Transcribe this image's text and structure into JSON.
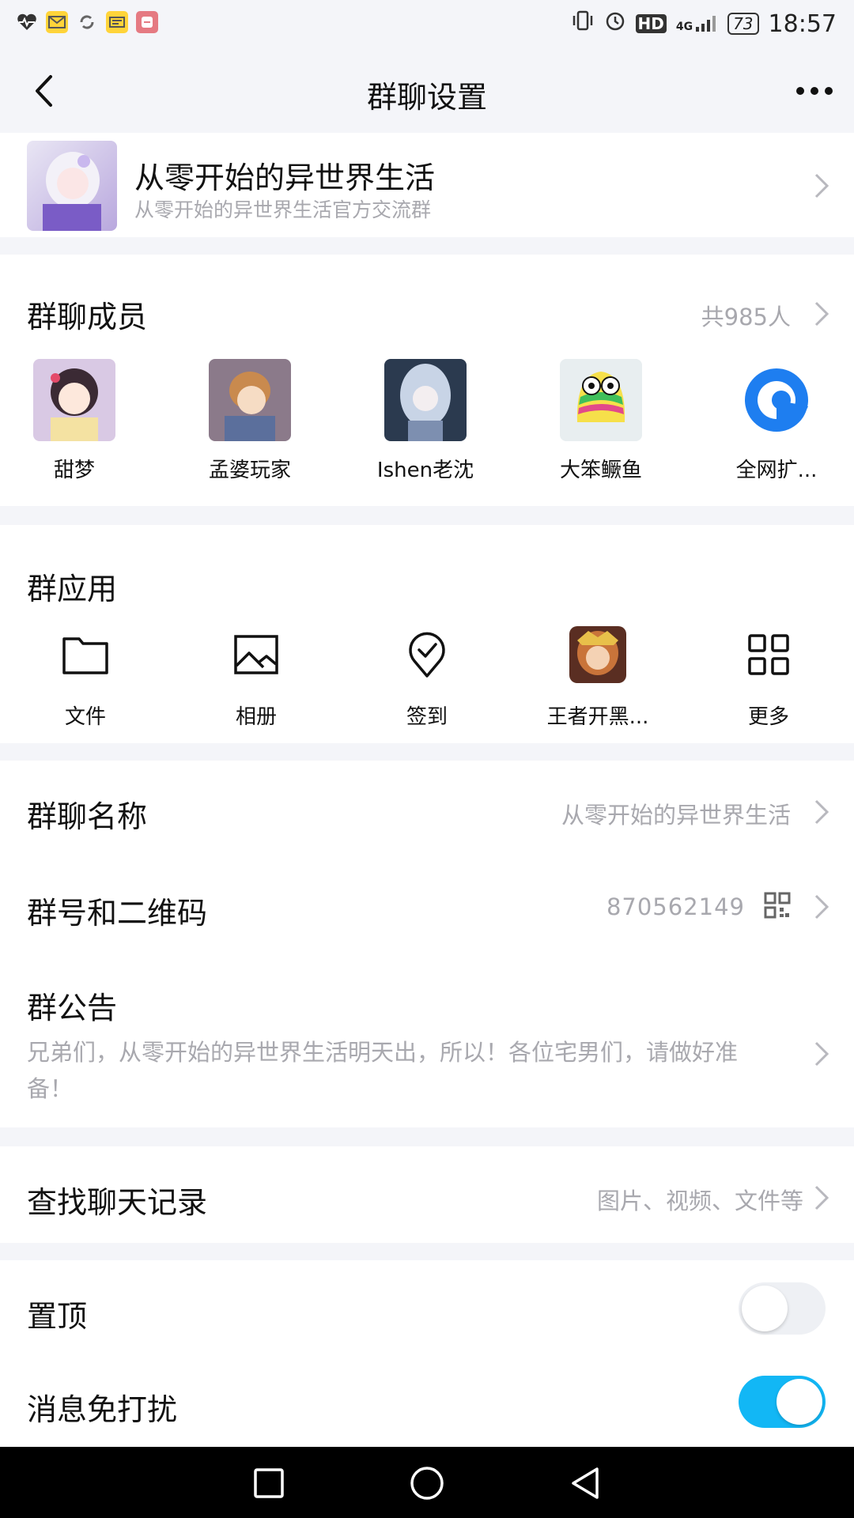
{
  "status_bar": {
    "time": "18:57",
    "battery": "73",
    "network": "4G",
    "hd": "HD",
    "app_icons": [
      "heart-rate-icon",
      "mail-icon",
      "sync-icon",
      "news-icon",
      "app-icon"
    ]
  },
  "navbar": {
    "title": "群聊设置"
  },
  "group": {
    "name": "从零开始的异世界生活",
    "description": "从零开始的异世界生活官方交流群"
  },
  "members": {
    "title": "群聊成员",
    "count": "共985人",
    "items": [
      {
        "name": "甜梦"
      },
      {
        "name": "孟婆玩家"
      },
      {
        "name": "Ishen老沈"
      },
      {
        "name": "大笨鳜鱼"
      },
      {
        "name": "全网扩..."
      }
    ]
  },
  "apps": {
    "title": "群应用",
    "items": [
      {
        "label": "文件",
        "icon": "folder-icon"
      },
      {
        "label": "相册",
        "icon": "photo-album-icon"
      },
      {
        "label": "签到",
        "icon": "check-in-icon"
      },
      {
        "label": "王者开黑...",
        "icon": "game-avatar-icon"
      },
      {
        "label": "更多",
        "icon": "grid-more-icon"
      }
    ]
  },
  "settings": {
    "group_name_label": "群聊名称",
    "group_name_value": "从零开始的异世界生活",
    "group_number_label": "群号和二维码",
    "group_number_value": "870562149",
    "notice_label": "群公告",
    "notice_text": "兄弟们，从零开始的异世界生活明天出，所以！各位宅男们，请做好准备！",
    "search_label": "查找聊天记录",
    "search_value": "图片、视频、文件等",
    "pin_label": "置顶",
    "pin_on": false,
    "mute_label": "消息免打扰",
    "mute_on": true
  },
  "colors": {
    "accent": "#12b7f5",
    "background": "#f4f5f9",
    "secondary_text": "#a8a8ae"
  }
}
